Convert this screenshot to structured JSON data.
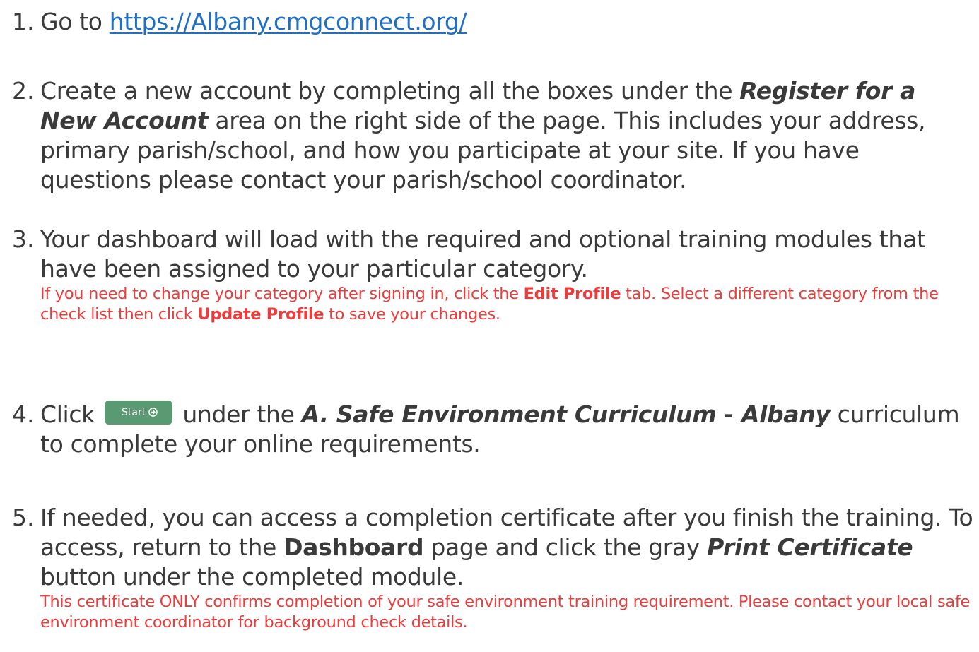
{
  "steps": [
    {
      "number": "1.",
      "parts": {
        "a": "Go to ",
        "link": "https://Albany.cmgconnect.org/"
      }
    },
    {
      "number": "2.",
      "parts": {
        "a": "Create a new account by completing all the boxes under the ",
        "em": "Register for a New Account",
        "b": " area on the right side of the page. This includes your address, primary parish/school, and how you participate at your site. If you have questions please contact your parish/school coordinator."
      }
    },
    {
      "number": "3.",
      "parts": {
        "a": "Your dashboard will load with the required and optional training modules that have been assigned to your particular category."
      },
      "note": {
        "a": "If you need to change your category after signing in, click the ",
        "b1": "Edit Profile",
        "c": " tab. Select a different category from the check list then click ",
        "b2": "Update Profile",
        "d": " to save your changes."
      }
    },
    {
      "number": "4.",
      "parts": {
        "a": "Click",
        "button": "Start",
        "b": "under the ",
        "em": "A. Safe Environment Curriculum - Albany",
        "c": " curriculum to complete your online requirements."
      }
    },
    {
      "number": "5.",
      "parts": {
        "a": "If needed, you can access a completion certificate after you finish the training. To access, return to the ",
        "b1": "Dashboard",
        "b": " page and click the gray ",
        "em": "Print Certificate",
        "c": " button under the completed module."
      },
      "note": {
        "a": "This certificate ONLY confirms completion of your safe environment training requirement. Please contact your local safe environment coordinator for background check details."
      }
    }
  ],
  "colors": {
    "text": "#3a3a3a",
    "link": "#1f6fc6",
    "note": "#ef3b3b",
    "button": "#5a9a73"
  },
  "icons": {
    "start_button_icon": "circle-arrow-right-icon"
  }
}
